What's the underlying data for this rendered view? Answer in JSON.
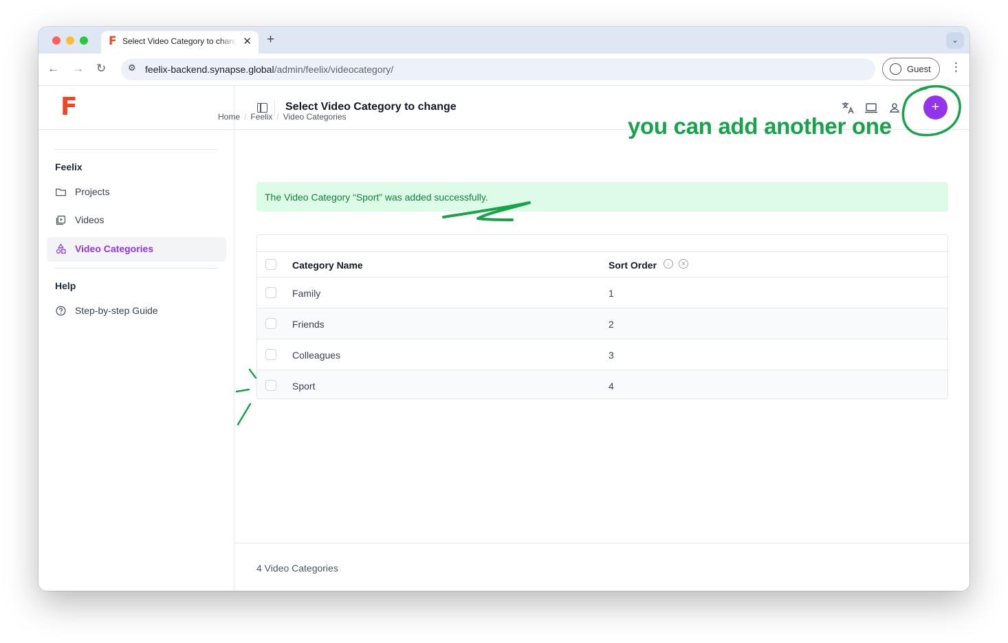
{
  "browser": {
    "tab_title": "Select Video Category to change",
    "tab_close": "✕",
    "new_tab": "+",
    "tab_search": "⌄",
    "url_host": "feelix-backend.synapse.global",
    "url_path": "/admin/feelix/videocategory/",
    "guest_label": "Guest",
    "menu": "⋮",
    "back": "←",
    "forward": "→",
    "reload": "↻",
    "site_info": "⚙"
  },
  "sidebar": {
    "logo": "F",
    "sections": [
      {
        "title": "Feelix",
        "items": [
          {
            "label": "Projects",
            "icon": "folder-icon",
            "active": false
          },
          {
            "label": "Videos",
            "icon": "video-library-icon",
            "active": false
          },
          {
            "label": "Video Categories",
            "icon": "category-shapes-icon",
            "active": true
          }
        ]
      },
      {
        "title": "Help",
        "items": [
          {
            "label": "Step-by-step Guide",
            "icon": "help-circle-icon",
            "active": false
          }
        ]
      }
    ]
  },
  "header": {
    "title": "Select Video Category to change",
    "add_label": "+"
  },
  "breadcrumb": [
    "Home",
    "Feelix",
    "Video Categories"
  ],
  "annotation": "you can add another one",
  "alert": "The Video Category “Sport” was added successfully.",
  "table": {
    "columns": [
      "Category Name",
      "Sort Order"
    ],
    "rows": [
      {
        "name": "Family",
        "order": "1"
      },
      {
        "name": "Friends",
        "order": "2"
      },
      {
        "name": "Colleagues",
        "order": "3"
      },
      {
        "name": "Sport",
        "order": "4"
      }
    ]
  },
  "footer": "4 Video Categories",
  "colors": {
    "accent": "#9333ea",
    "success_bg": "#dcfce7",
    "success_text": "#15803d",
    "annotation": "#16a34a",
    "logo": "#ef4623"
  }
}
